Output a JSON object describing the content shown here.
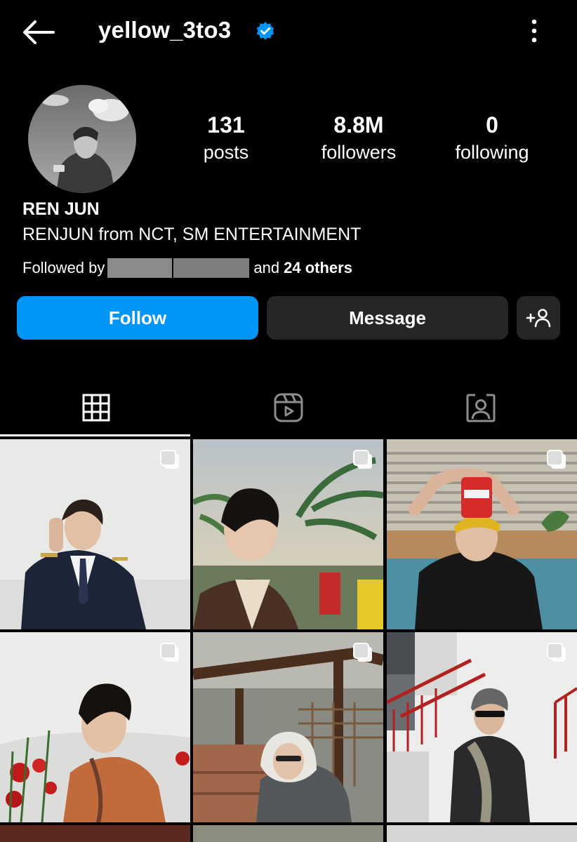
{
  "header": {
    "username": "yellow_3to3",
    "verified": true,
    "back_icon": "arrow-left-icon",
    "more_icon": "more-vertical-icon"
  },
  "profile": {
    "stats": [
      {
        "value": "131",
        "label": "posts"
      },
      {
        "value": "8.8M",
        "label": "followers"
      },
      {
        "value": "0",
        "label": "following"
      }
    ],
    "display_name": "REN JUN",
    "bio": "RENJUN from NCT, SM ENTERTAINMENT",
    "followed_by": {
      "prefix": "Followed by",
      "and": "and",
      "others": "24 others"
    }
  },
  "actions": {
    "follow_label": "Follow",
    "message_label": "Message",
    "add_icon": "add-person-icon"
  },
  "tabs": [
    {
      "icon": "grid-icon",
      "active": true
    },
    {
      "icon": "reels-icon",
      "active": false
    },
    {
      "icon": "tagged-icon",
      "active": false
    }
  ],
  "posts": [
    {
      "multi": true
    },
    {
      "multi": true
    },
    {
      "multi": true
    },
    {
      "multi": true
    },
    {
      "multi": true
    },
    {
      "multi": true
    }
  ],
  "colors": {
    "background": "#000000",
    "follow_button": "#0095f6",
    "secondary_button": "#262626",
    "verified_badge": "#0095f6"
  }
}
